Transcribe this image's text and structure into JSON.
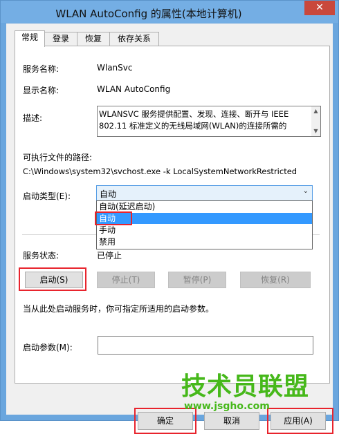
{
  "window": {
    "title": "WLAN AutoConfig 的属性(本地计算机)",
    "close_glyph": "✕"
  },
  "tabs": [
    {
      "label": "常规"
    },
    {
      "label": "登录"
    },
    {
      "label": "恢复"
    },
    {
      "label": "依存关系"
    }
  ],
  "general": {
    "service_name_label": "服务名称:",
    "service_name_value": "WlanSvc",
    "display_name_label": "显示名称:",
    "display_name_value": "WLAN AutoConfig",
    "description_label": "描述:",
    "description_line1": "WLANSVC 服务提供配置、发现、连接、断开与 IEEE",
    "description_line2": "802.11 标准定义的无线局域网(WLAN)的连接所需的",
    "path_label": "可执行文件的路径:",
    "path_value": "C:\\Windows\\system32\\svchost.exe -k LocalSystemNetworkRestricted",
    "startup_type_label": "启动类型(E):",
    "startup_type_value": "自动",
    "startup_options": [
      "自动(延迟启动)",
      "自动",
      "手动",
      "禁用"
    ],
    "selected_option_index": 1,
    "service_status_label": "服务状态:",
    "service_status_value": "已停止",
    "start_button": "启动(S)",
    "stop_button": "停止(T)",
    "pause_button": "暂停(P)",
    "resume_button": "恢复(R)",
    "hint_text": "当从此处启动服务时，你可指定所适用的启动参数。",
    "start_params_label": "启动参数(M):",
    "start_params_value": ""
  },
  "footer": {
    "ok_button": "确定",
    "cancel_button": "取消",
    "apply_button": "应用(A)"
  },
  "watermark": {
    "main": "技术员联盟",
    "url": "www.jsgho.com"
  },
  "colors": {
    "titlebar": "#74aee4",
    "close": "#c9483c",
    "highlight": "#3399ff",
    "annotation": "#e8242d",
    "watermark": "#46b81a"
  }
}
